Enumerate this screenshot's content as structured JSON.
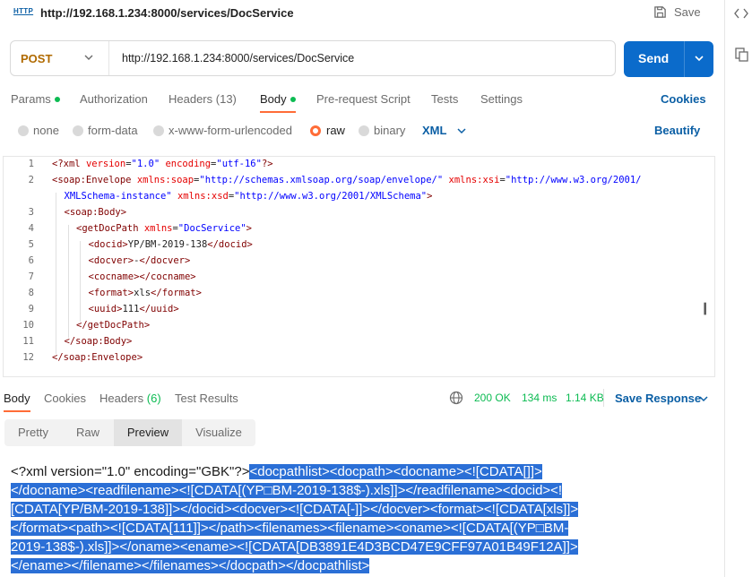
{
  "title_bar": {
    "badge": "HTTP",
    "title": "http://192.168.1.234:8000/services/DocService",
    "save_label": "Save"
  },
  "request": {
    "method": "POST",
    "url": "http://192.168.1.234:8000/services/DocService",
    "send_label": "Send"
  },
  "tabs": [
    {
      "label": "Params",
      "dot": true
    },
    {
      "label": "Authorization"
    },
    {
      "label": "Headers",
      "count": "(13)"
    },
    {
      "label": "Body",
      "dot": true,
      "active": true
    },
    {
      "label": "Pre-request Script"
    },
    {
      "label": "Tests"
    },
    {
      "label": "Settings"
    }
  ],
  "cookies_label": "Cookies",
  "body_types": [
    "none",
    "form-data",
    "x-www-form-urlencoded",
    "raw",
    "binary"
  ],
  "body_type_selected": "raw",
  "raw_format": "XML",
  "beautify_label": "Beautify",
  "editor": {
    "line_numbers": [
      "1",
      "2",
      "",
      "3",
      "4",
      "5",
      "6",
      "7",
      "8",
      "9",
      "10",
      "11",
      "12"
    ],
    "lines": [
      {
        "segments": [
          [
            "tag",
            "<?xml "
          ],
          [
            "attr",
            "version"
          ],
          [
            "txt",
            "="
          ],
          [
            "val",
            "\"1.0\""
          ],
          [
            "txt",
            " "
          ],
          [
            "attr",
            "encoding"
          ],
          [
            "txt",
            "="
          ],
          [
            "val",
            "\"utf-16\""
          ],
          [
            "tag",
            "?>"
          ]
        ]
      },
      {
        "segments": [
          [
            "tag",
            "<soap:Envelope "
          ],
          [
            "attr",
            "xmlns:soap"
          ],
          [
            "txt",
            "="
          ],
          [
            "val",
            "\"http://schemas.xmlsoap.org/soap/envelope/\""
          ],
          [
            "txt",
            " "
          ],
          [
            "attr",
            "xmlns:xsi"
          ],
          [
            "txt",
            "="
          ],
          [
            "val",
            "\"http://www.w3.org/2001/"
          ]
        ]
      },
      {
        "segments": [
          [
            "val",
            "XMLSchema-instance\""
          ],
          [
            "txt",
            " "
          ],
          [
            "attr",
            "xmlns:xsd"
          ],
          [
            "txt",
            "="
          ],
          [
            "val",
            "\"http://www.w3.org/2001/XMLSchema\""
          ],
          [
            "tag",
            ">"
          ]
        ]
      },
      {
        "segments": [
          [
            "tag",
            "<soap:Body>"
          ]
        ]
      },
      {
        "segments": [
          [
            "tag",
            "<getDocPath "
          ],
          [
            "attr",
            "xmlns"
          ],
          [
            "txt",
            "="
          ],
          [
            "val",
            "\"DocService\""
          ],
          [
            "tag",
            ">"
          ]
        ]
      },
      {
        "segments": [
          [
            "tag",
            "<docid>"
          ],
          [
            "txt",
            "YP/BM-2019-138"
          ],
          [
            "tag",
            "</docid>"
          ]
        ]
      },
      {
        "segments": [
          [
            "tag",
            "<docver>"
          ],
          [
            "txt",
            "-"
          ],
          [
            "tag",
            "</docver>"
          ]
        ]
      },
      {
        "segments": [
          [
            "tag",
            "<cocname></cocname>"
          ]
        ]
      },
      {
        "segments": [
          [
            "tag",
            "<format>"
          ],
          [
            "txt",
            "xls"
          ],
          [
            "tag",
            "</format>"
          ]
        ]
      },
      {
        "segments": [
          [
            "tag",
            "<uuid>"
          ],
          [
            "txt",
            "111"
          ],
          [
            "tag",
            "</uuid>"
          ]
        ]
      },
      {
        "segments": [
          [
            "tag",
            "</getDocPath>"
          ]
        ]
      },
      {
        "segments": [
          [
            "tag",
            "</soap:Body>"
          ]
        ]
      },
      {
        "segments": [
          [
            "tag",
            "</soap:Envelope>"
          ]
        ]
      }
    ]
  },
  "response": {
    "tabs": [
      {
        "label": "Body",
        "active": true
      },
      {
        "label": "Cookies"
      },
      {
        "label": "Headers",
        "count": "(6)"
      },
      {
        "label": "Test Results"
      }
    ],
    "status": "200 OK",
    "time": "134 ms",
    "size": "1.14 KB",
    "save_label": "Save Response",
    "views": [
      "Pretty",
      "Raw",
      "Preview",
      "Visualize"
    ],
    "active_view": "Preview",
    "preview_plain": "<?xml version=\"1.0\" encoding=\"GBK\"?>",
    "preview_lines": [
      "<docpathlist><docpath><docname><![CDATA[]]>",
      "</docname><readfilename><![CDATA[(YP□BM-2019-138$-).xls]]></readfilename><docid><!",
      "[CDATA[YP/BM-2019-138]]></docid><docver><![CDATA[-]]></docver><format><![CDATA[xls]]>",
      "</format><path><![CDATA[111]]></path><filenames><filename><oname><![CDATA[(YP□BM-",
      "2019-138$-).xls]]></oname><ename><![CDATA[DB3891E4D3BCD47E9CFF97A01B49F12A]]>",
      "</ename></filename></filenames></docpath></docpathlist>"
    ]
  },
  "colors": {
    "accent": "#ff6c37",
    "primary": "#0b6bcb",
    "link": "#0b5fa5",
    "success": "#0cbb52",
    "method": "#b06a00",
    "selection": "#2b6fd6"
  }
}
